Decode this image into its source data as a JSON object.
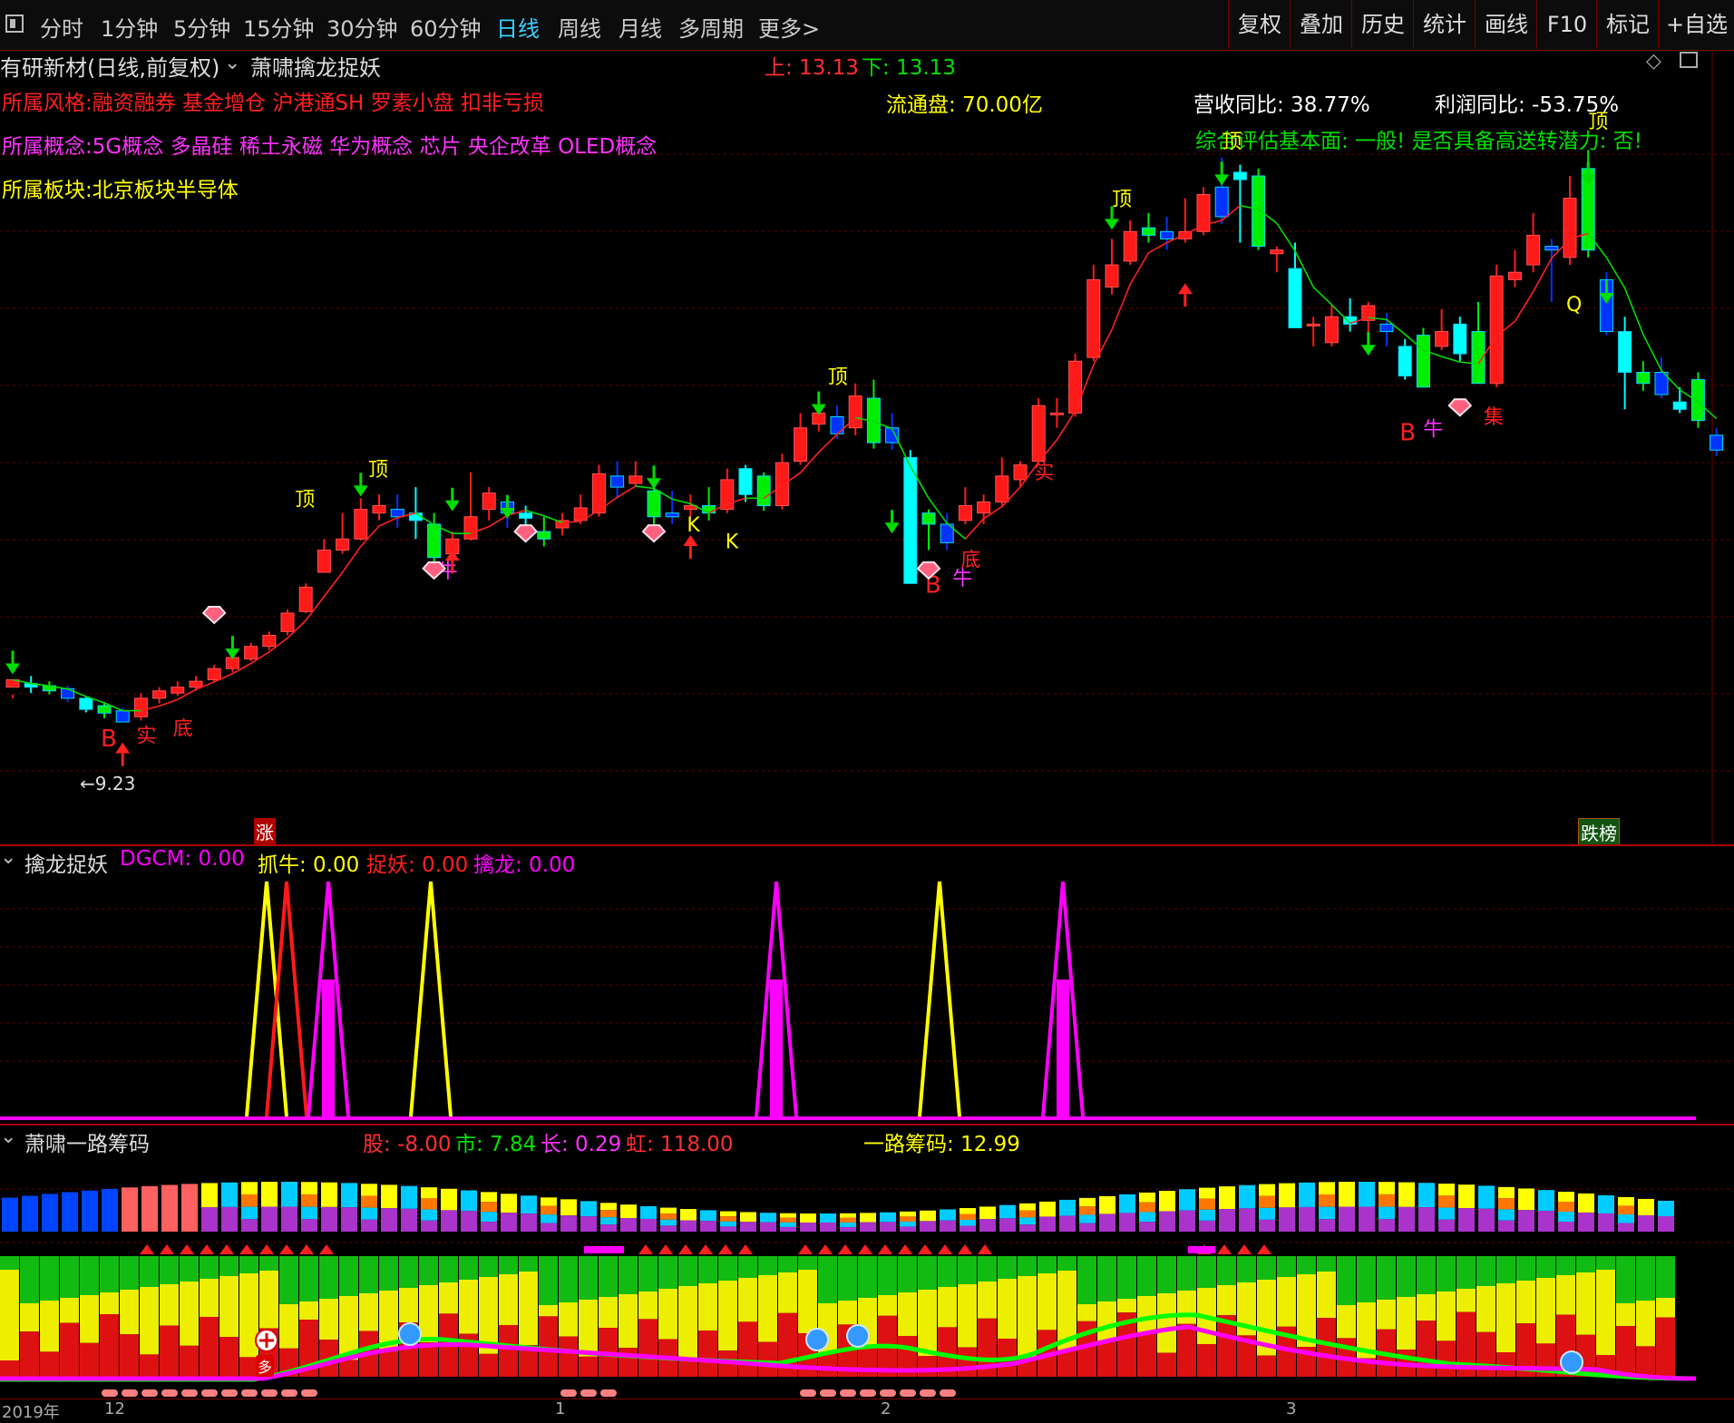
{
  "toolbar": {
    "tabs": [
      "分时",
      "1分钟",
      "5分钟",
      "15分钟",
      "30分钟",
      "60分钟",
      "日线",
      "周线",
      "月线",
      "多周期",
      "更多>"
    ],
    "active_tab": "日线",
    "right_buttons": [
      "复权",
      "叠加",
      "历史",
      "统计",
      "画线",
      "F10",
      "标记",
      "+自选"
    ]
  },
  "main_header": {
    "stock": "有研新材(日线,前复权)",
    "indicator": "萧啸擒龙捉妖",
    "upper": "上: 13.13",
    "lower": "下: 13.13",
    "style_line": "所属风格:融资融券 基金增仓 沪港通SH 罗素小盘 扣非亏损",
    "concept_line": "所属概念:5G概念 多晶硅 稀土永磁 华为概念 芯片 央企改革 OLED概念",
    "sector_line": "所属板块:北京板块半导体",
    "float_cap": "流通盘: 70.00亿",
    "revenue_yoy": "营收同比: 38.77%",
    "profit_yoy": "利润同比: -53.75%",
    "fundamental": "综合评估基本面: 一般! 是否具备高送转潜力: 否!",
    "low_marker": "←9.23",
    "tag_up": "涨",
    "tag_list": "跌榜"
  },
  "chart_labels": {
    "top": "顶",
    "bottom": "底",
    "solid": "实",
    "buy": "B",
    "bull": "牛",
    "k": "K",
    "q": "Q",
    "gather": "集"
  },
  "panel2": {
    "name": "擒龙捉妖",
    "dgcm": "DGCM: 0.00",
    "zhuaniu": "抓牛: 0.00",
    "zhuoyao": "捉妖: 0.00",
    "qinlong": "擒龙: 0.00"
  },
  "panel3": {
    "name": "萧啸一路筹码",
    "gu": "股: -8.00",
    "shi": "市: 7.84",
    "chang": "长: 0.29",
    "hong": "虹: 118.00",
    "chip": "一路筹码: 12.99",
    "marker_duo": "多"
  },
  "x_axis": [
    "2019年",
    "12",
    "1",
    "2",
    "3"
  ],
  "colors": {
    "up": "#ff1a1a",
    "down_blue": "#0033ff",
    "down_cyan": "#00ffff",
    "green": "#00ee00",
    "yellow": "#ffff00",
    "magenta": "#ff00ff",
    "panel_border": "#aa0000"
  },
  "chart_data": {
    "type": "candlestick",
    "candles": [
      [
        9.7,
        9.8,
        9.6,
        9.55
      ],
      [
        9.75,
        9.7,
        9.85,
        9.62
      ],
      [
        9.72,
        9.65,
        9.78,
        9.6
      ],
      [
        9.68,
        9.55,
        9.72,
        9.5
      ],
      [
        9.55,
        9.4,
        9.58,
        9.36
      ],
      [
        9.45,
        9.35,
        9.5,
        9.28
      ],
      [
        9.38,
        9.23,
        9.42,
        9.23
      ],
      [
        9.3,
        9.55,
        9.62,
        9.25
      ],
      [
        9.55,
        9.65,
        9.7,
        9.48
      ],
      [
        9.62,
        9.7,
        9.78,
        9.58
      ],
      [
        9.7,
        9.78,
        9.85,
        9.65
      ],
      [
        9.8,
        9.95,
        10.0,
        9.78
      ],
      [
        9.95,
        10.1,
        10.16,
        9.9
      ],
      [
        10.08,
        10.25,
        10.3,
        10.05
      ],
      [
        10.25,
        10.4,
        10.45,
        10.2
      ],
      [
        10.45,
        10.7,
        10.75,
        10.4
      ],
      [
        10.72,
        11.05,
        11.1,
        10.7
      ],
      [
        11.25,
        11.55,
        11.7,
        11.25
      ],
      [
        11.55,
        11.7,
        12.05,
        11.5
      ],
      [
        11.7,
        12.1,
        12.25,
        11.68
      ],
      [
        12.05,
        12.15,
        12.3,
        11.95
      ],
      [
        12.1,
        12.0,
        12.3,
        11.85
      ],
      [
        12.05,
        11.95,
        12.4,
        11.7
      ],
      [
        11.9,
        11.45,
        12.05,
        11.35
      ],
      [
        11.5,
        11.7,
        11.8,
        11.4
      ],
      [
        11.7,
        12.0,
        12.6,
        11.68
      ],
      [
        12.1,
        12.32,
        12.4,
        11.95
      ],
      [
        12.2,
        12.05,
        12.3,
        11.85
      ],
      [
        12.05,
        11.98,
        12.15,
        11.8
      ],
      [
        11.8,
        11.7,
        12.0,
        11.6
      ],
      [
        11.85,
        11.95,
        12.05,
        11.75
      ],
      [
        11.95,
        12.12,
        12.3,
        11.9
      ],
      [
        12.05,
        12.58,
        12.7,
        12.0
      ],
      [
        12.55,
        12.4,
        12.75,
        12.25
      ],
      [
        12.45,
        12.55,
        12.75,
        12.4
      ],
      [
        12.35,
        12.0,
        12.45,
        11.9
      ],
      [
        12.05,
        12.0,
        12.35,
        11.9
      ],
      [
        12.1,
        12.15,
        12.3,
        12.0
      ],
      [
        12.15,
        12.05,
        12.4,
        11.95
      ],
      [
        12.1,
        12.5,
        12.65,
        12.05
      ],
      [
        12.65,
        12.3,
        12.7,
        12.2
      ],
      [
        12.55,
        12.15,
        12.6,
        12.08
      ],
      [
        12.15,
        12.73,
        12.85,
        12.1
      ],
      [
        12.75,
        13.2,
        13.4,
        12.7
      ],
      [
        13.25,
        13.4,
        13.65,
        13.15
      ],
      [
        13.35,
        13.12,
        13.5,
        13.05
      ],
      [
        13.2,
        13.63,
        13.8,
        13.1
      ],
      [
        13.6,
        13.0,
        13.85,
        12.92
      ],
      [
        13.2,
        13.0,
        13.4,
        12.9
      ],
      [
        12.8,
        11.1,
        12.9,
        11.1
      ],
      [
        12.05,
        11.9,
        12.1,
        11.55
      ],
      [
        11.9,
        11.65,
        12.05,
        11.55
      ],
      [
        11.95,
        12.15,
        12.4,
        11.9
      ],
      [
        12.05,
        12.2,
        12.3,
        11.9
      ],
      [
        12.2,
        12.55,
        12.8,
        12.15
      ],
      [
        12.5,
        12.7,
        12.75,
        12.4
      ],
      [
        12.75,
        13.5,
        13.6,
        12.7
      ],
      [
        13.4,
        13.4,
        13.6,
        13.2
      ],
      [
        13.4,
        14.1,
        14.2,
        13.35
      ],
      [
        14.15,
        15.2,
        15.4,
        14.1
      ],
      [
        15.1,
        15.4,
        15.75,
        15.0
      ],
      [
        15.45,
        15.85,
        16.0,
        15.4
      ],
      [
        15.9,
        15.8,
        16.1,
        15.7
      ],
      [
        15.85,
        15.75,
        16.05,
        15.6
      ],
      [
        15.75,
        15.85,
        16.3,
        15.7
      ],
      [
        15.85,
        16.35,
        16.45,
        15.8
      ],
      [
        16.45,
        16.05,
        16.85,
        15.95
      ],
      [
        16.65,
        16.55,
        16.75,
        15.7
      ],
      [
        16.6,
        15.65,
        16.7,
        15.6
      ],
      [
        15.55,
        15.6,
        15.65,
        15.3
      ],
      [
        15.35,
        14.55,
        15.7,
        14.55
      ],
      [
        14.6,
        14.6,
        14.7,
        14.3
      ],
      [
        14.35,
        14.7,
        14.85,
        14.3
      ],
      [
        14.7,
        14.6,
        14.95,
        14.5
      ],
      [
        14.65,
        14.85,
        14.9,
        14.2
      ],
      [
        14.6,
        14.5,
        14.75,
        14.3
      ],
      [
        14.3,
        13.9,
        14.4,
        13.85
      ],
      [
        14.45,
        13.75,
        14.55,
        13.75
      ],
      [
        14.3,
        14.5,
        14.8,
        14.25
      ],
      [
        14.6,
        14.2,
        14.7,
        14.1
      ],
      [
        14.5,
        13.8,
        14.9,
        13.8
      ],
      [
        13.8,
        15.25,
        15.4,
        13.75
      ],
      [
        15.2,
        15.3,
        15.6,
        15.1
      ],
      [
        15.4,
        15.8,
        16.1,
        15.3
      ],
      [
        15.65,
        15.6,
        15.75,
        14.9
      ],
      [
        15.5,
        16.3,
        16.6,
        15.4
      ],
      [
        16.7,
        15.6,
        16.95,
        15.5
      ],
      [
        15.2,
        14.5,
        15.3,
        14.45
      ],
      [
        14.5,
        13.95,
        14.7,
        13.45
      ],
      [
        13.95,
        13.8,
        14.1,
        13.7
      ],
      [
        13.95,
        13.65,
        14.15,
        13.6
      ],
      [
        13.55,
        13.45,
        13.75,
        13.4
      ],
      [
        13.85,
        13.3,
        13.95,
        13.2
      ],
      [
        13.1,
        12.9,
        13.2,
        12.82
      ]
    ],
    "up_color_indices_red": true
  }
}
